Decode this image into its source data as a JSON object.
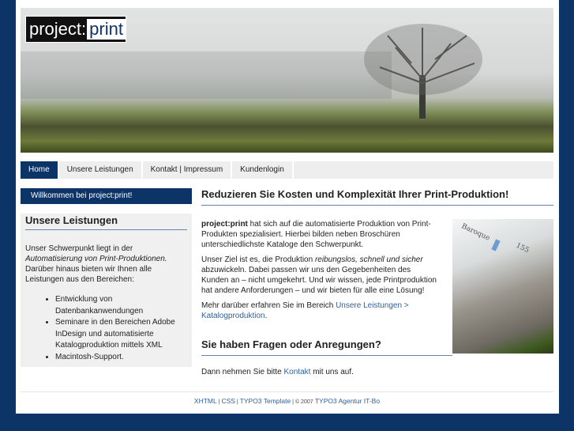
{
  "logo": {
    "part1": "project:",
    "part2": "print"
  },
  "nav": [
    {
      "label": "Home"
    },
    {
      "label": "Unsere Leistungen"
    },
    {
      "label": "Kontakt | Impressum"
    },
    {
      "label": "Kundenlogin"
    }
  ],
  "sidebar": {
    "welcome": "Willkommen bei project:print!",
    "title": "Unsere Leistungen",
    "intro1": "Unser Schwerpunkt liegt in der",
    "intro_em": "Automatisierung von Print-Produktionen.",
    "intro2": "Darüber hinaus bieten wir Ihnen alle Leistungen aus den Bereichen:",
    "items": [
      "Entwicklung von Datenbankanwendungen",
      "Seminare in den Bereichen Adobe InDesign und automatisierte Katalogproduktion mittels XML",
      "Macintosh-Support."
    ]
  },
  "main": {
    "title": "Reduzieren Sie Kosten und Komplexität Ihrer Print-Produktion!",
    "p1_bold": "project:print",
    "p1": " hat sich auf die automatisierte Produktion von Print-Produkten spezialisiert. Hierbei bilden neben Broschüren unterschiedlichste Kataloge den Schwerpunkt.",
    "p2a": "Unser Ziel ist es, die Produktion ",
    "p2_em": "reibungslos, schnell und sicher",
    "p2b": " abzuwickeln. Dabei passen wir uns den Gegebenheiten des Kunden an – nicht umgekehrt. Und wir wissen, jede Printproduktion hat andere Anforderungen – und wir bieten für alle eine Lösung!",
    "p3a": "Mehr darüber erfahren Sie im Bereich ",
    "p3_link1": "Unsere Leistungen >",
    "p3_link2": "Katalogproduktion",
    "p3b": ".",
    "image_text1": "Baroque",
    "image_text2": "155",
    "title2": "Sie haben Fragen oder Anregungen?",
    "p4a": "Dann nehmen Sie bitte ",
    "p4_link": "Kontakt",
    "p4b": " mit uns auf."
  },
  "footer": {
    "xhtml": "XHTML",
    "css": "CSS",
    "template": "TYPO3 Template",
    "copy": "© 2007",
    "agency": "TYPO3 Agentur IT-Bo",
    "sep": " | "
  }
}
